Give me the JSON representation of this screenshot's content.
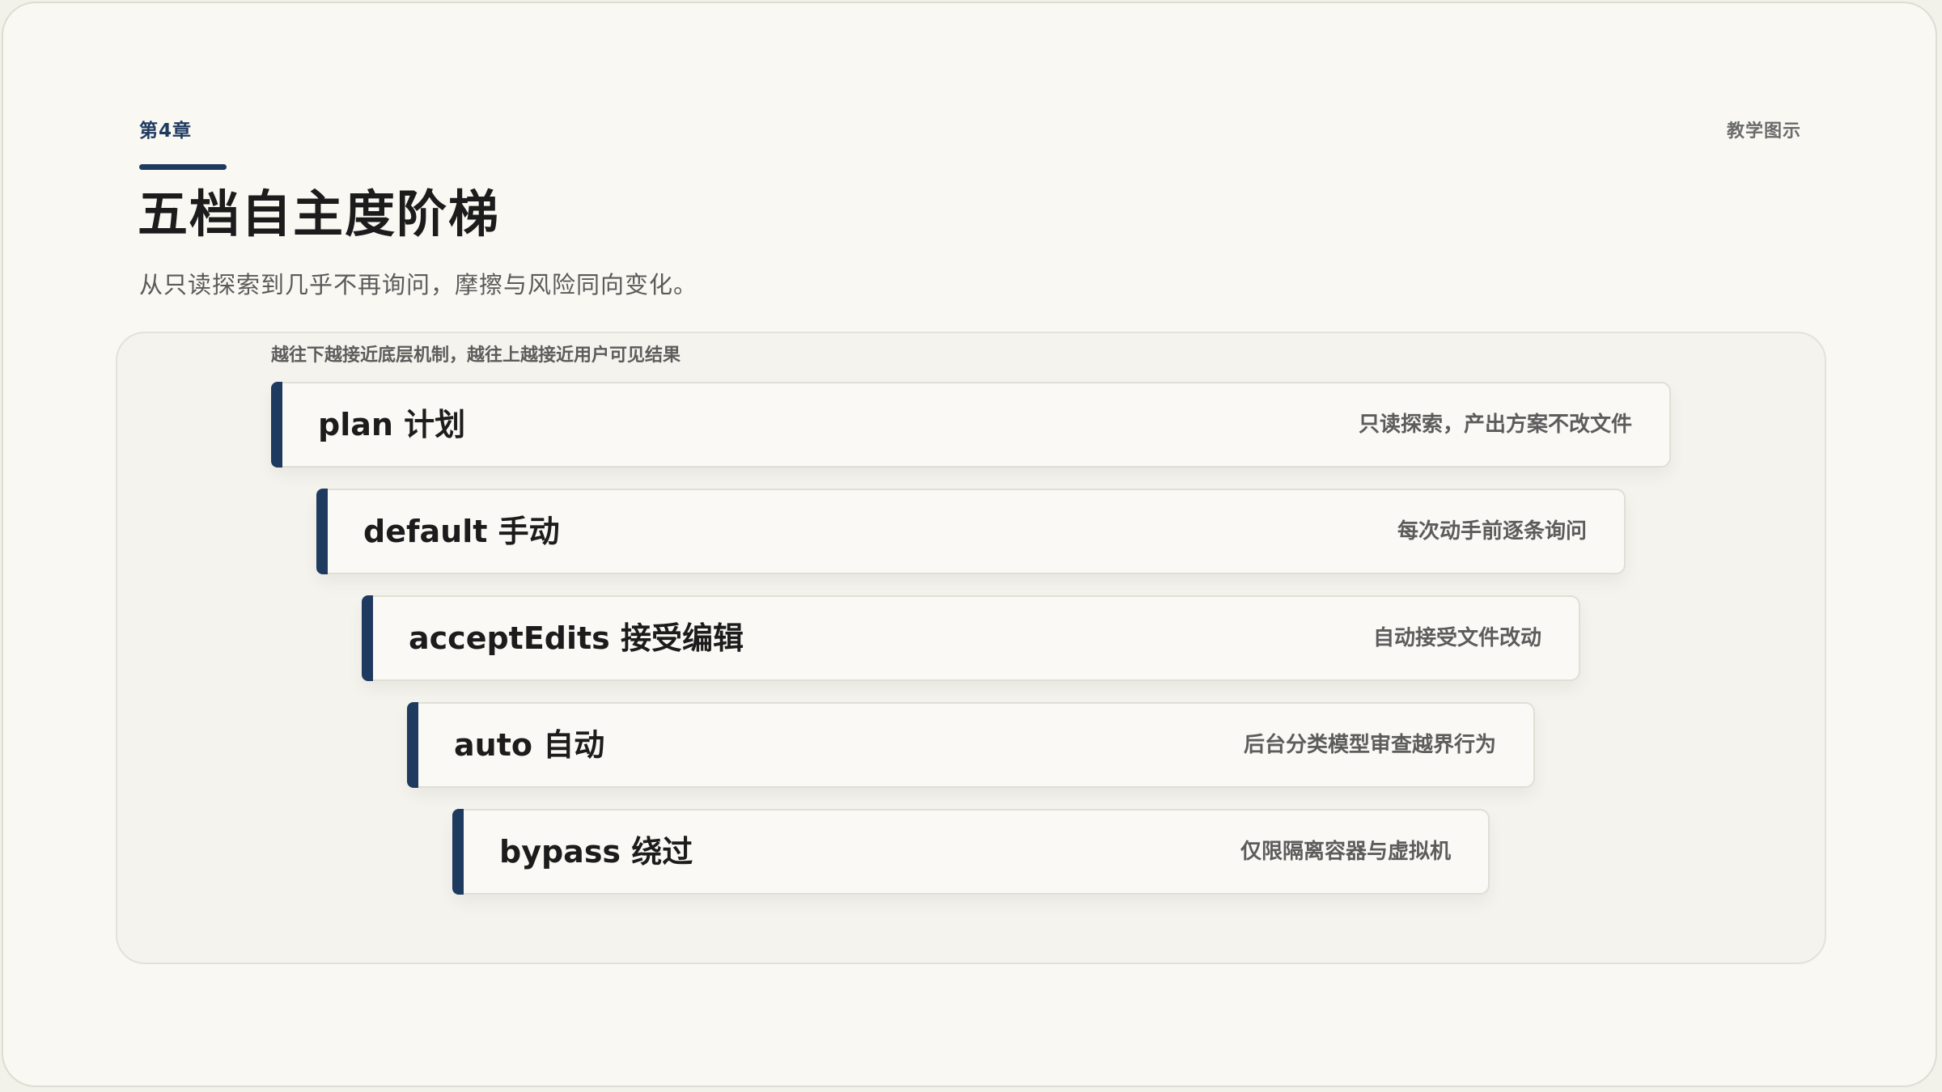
{
  "header": {
    "chapter": "第4章",
    "tag": "教学图示",
    "title": "五档自主度阶梯",
    "subtitle": "从只读探索到几乎不再询问，摩擦与风险同向变化。"
  },
  "diagram": {
    "caption": "越往下越接近底层机制，越往上越接近用户可见结果",
    "steps": [
      {
        "name": "plan 计划",
        "description": "只读探索，产出方案不改文件"
      },
      {
        "name": "default 手动",
        "description": "每次动手前逐条询问"
      },
      {
        "name": "acceptEdits 接受编辑",
        "description": "自动接受文件改动"
      },
      {
        "name": "auto 自动",
        "description": "后台分类模型审查越界行为"
      },
      {
        "name": "bypass 绕过",
        "description": "仅限隔离容器与虚拟机"
      }
    ]
  },
  "colors": {
    "accent": "#1f3a5f",
    "background": "#f9f8f3",
    "panel": "#f4f3ed"
  }
}
